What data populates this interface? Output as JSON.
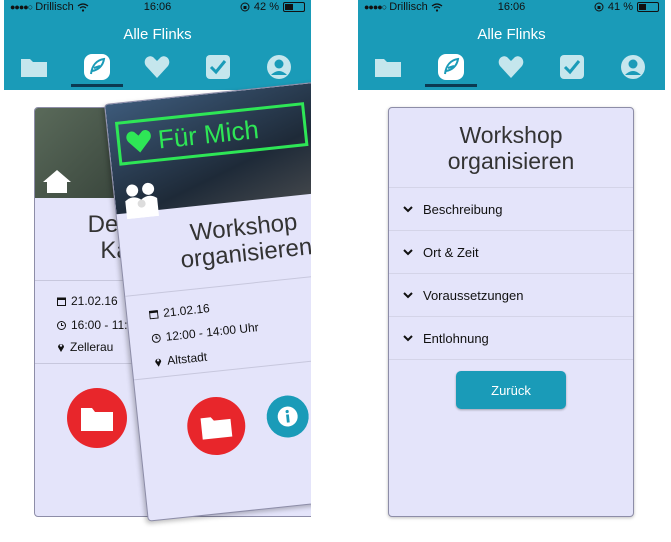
{
  "colors": {
    "nav": "#1a9bb8",
    "card": "#e4e4fa",
    "heart": "#2ee656",
    "folder_btn": "#e8262b",
    "info_btn": "#1a9bb8",
    "nav_active_bar": "#0b3a52"
  },
  "left": {
    "status": {
      "carrier": "Drillisch",
      "time": "16:06",
      "battery": "42 %",
      "battery_level": 0.42
    },
    "title": "Alle Flinks",
    "tabs": [
      "folder-icon",
      "leaf-icon",
      "heart-icon",
      "checkbox-icon",
      "user-icon"
    ],
    "active_tab": "leaf-icon",
    "back_card": {
      "title_line1": "Deutsc",
      "title_line2": "Kam",
      "date": "21.02.16",
      "time": "16:00 - 11:",
      "place": "Zellerau"
    },
    "front_card": {
      "badge": "Für Mich",
      "title_line1": "Workshop",
      "title_line2": "organisieren",
      "date": "21.02.16",
      "time": "12:00 - 14:00 Uhr",
      "place": "Altstadt"
    }
  },
  "right": {
    "status": {
      "carrier": "Drillisch",
      "time": "16:06",
      "battery": "41 %",
      "battery_level": 0.41
    },
    "title": "Alle Flinks",
    "tabs": [
      "folder-icon",
      "leaf-icon",
      "heart-icon",
      "checkbox-icon",
      "user-icon"
    ],
    "active_tab": "leaf-icon",
    "card": {
      "title_line1": "Workshop",
      "title_line2": "organisieren",
      "sections": [
        "Beschreibung",
        "Ort & Zeit",
        "Voraussetzungen",
        "Entlohnung"
      ],
      "back_button": "Zurück"
    }
  }
}
